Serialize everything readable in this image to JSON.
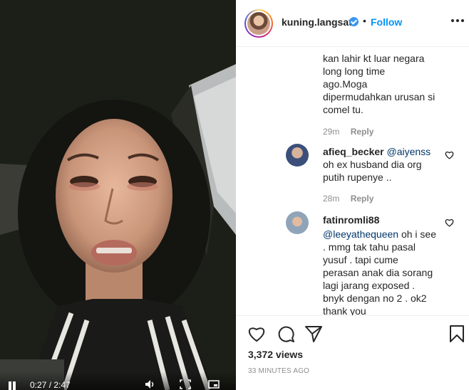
{
  "video": {
    "time": "0:27 / 2:47",
    "icons": [
      "pause-icon",
      "volume-icon",
      "picture-in-picture-icon",
      "fullscreen-icon"
    ]
  },
  "header": {
    "username": "kuning.langsat",
    "separator": "•",
    "follow_label": "Follow"
  },
  "comments": [
    {
      "user": "",
      "text_lines": [
        "kan lahir kt luar negara",
        "long long time",
        "ago.Moga",
        "dipermudahkan urusan si",
        "comel tu."
      ],
      "time": "29m",
      "reply_label": "Reply"
    },
    {
      "user": "afieq_becker",
      "mention": "@aiyenss",
      "text_lines": [
        "oh ex husband dia org",
        "putih rupenye .."
      ],
      "time": "28m",
      "reply_label": "Reply"
    },
    {
      "user": "fatinromli88",
      "mention": "@leeyathequeen",
      "first_line_rest": "oh i see",
      "text_lines": [
        ". mmg tak tahu pasal",
        "yusuf . tapi cume",
        "perasan anak dia sorang",
        "lagi jarang exposed .",
        "bnyk dengan no 2 . ok2",
        "thank you"
      ]
    }
  ],
  "actions": {
    "views": "3,372 views",
    "posted": "33 MINUTES AGO"
  },
  "colors": {
    "accent": "#0095f6",
    "verified": "#3897f0",
    "meta": "#8e8e8e",
    "mention": "#00376b"
  }
}
